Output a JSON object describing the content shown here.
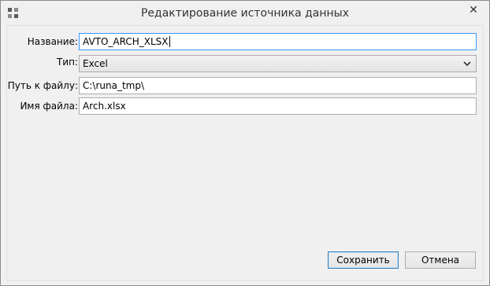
{
  "window": {
    "title": "Редактирование источника данных",
    "close_label": "✕"
  },
  "form": {
    "name": {
      "label": "Название:",
      "value": "AVTO_ARCH_XLSX"
    },
    "type": {
      "label": "Тип:",
      "value": "Excel"
    },
    "path": {
      "label": "Путь к файлу:",
      "value": "C:\\runa_tmp\\"
    },
    "filename": {
      "label": "Имя файла:",
      "value": "Arch.xlsx"
    }
  },
  "buttons": {
    "save": "Сохранить",
    "cancel": "Отмена"
  }
}
